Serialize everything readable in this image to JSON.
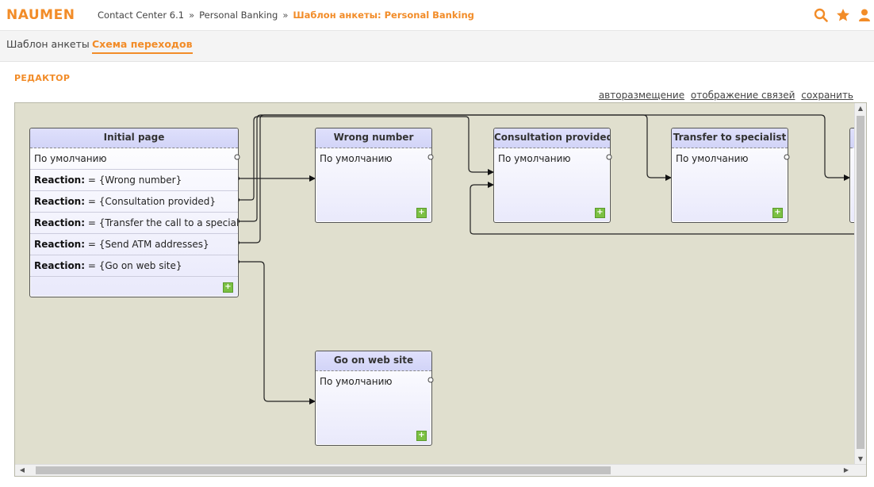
{
  "header": {
    "logo": "NAUMEN",
    "breadcrumbs": [
      "Contact Center 6.1",
      "Personal Banking"
    ],
    "separator": "»",
    "current": "Шаблон анкеты: Personal Banking",
    "icons": [
      "search-icon",
      "star-icon",
      "user-icon"
    ],
    "accent_color": "#f28c28"
  },
  "tabs": [
    {
      "label": "Шаблон анкеты",
      "active": false
    },
    {
      "label": "Схема переходов",
      "active": true
    }
  ],
  "editor": {
    "title": "РЕДАКТОР",
    "toolbar": [
      "авторазмещение",
      "отображение связей",
      "сохранить"
    ]
  },
  "nodes": {
    "initial": {
      "title": "Initial page",
      "default_row": "По умолчанию",
      "reaction_label": "Reaction:",
      "reactions": [
        "= {Wrong number}",
        "= {Consultation provided}",
        "= {Transfer the call to a specialist}",
        "= {Send ATM addresses}",
        "= {Go on web site}"
      ]
    },
    "wrong_number": {
      "title": "Wrong number",
      "default_row": "По умолчанию"
    },
    "consultation": {
      "title": "Consultation provided",
      "default_row": "По умолчанию"
    },
    "transfer": {
      "title": "Transfer to specialist",
      "default_row": "По умолчанию"
    },
    "web_site": {
      "title": "Go on web site",
      "default_row": "По умолчанию"
    }
  },
  "add_button_symbol": "+"
}
